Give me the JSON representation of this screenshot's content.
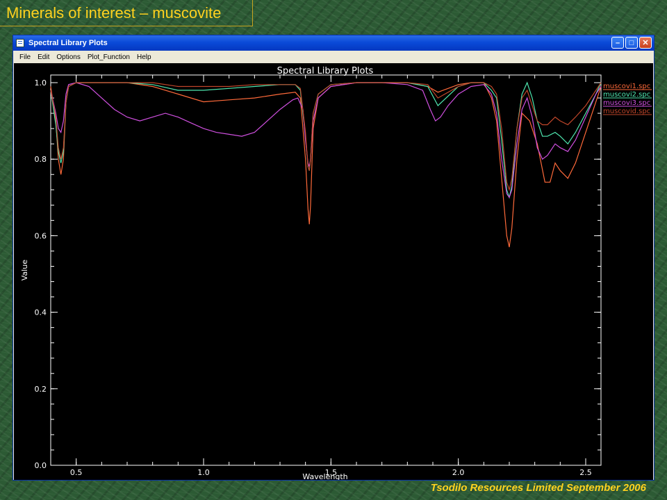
{
  "slide": {
    "title": "Minerals of interest – muscovite",
    "footer": "Tsodilo Resources Limited September 2006"
  },
  "window": {
    "title": "Spectral Library Plots",
    "menu": [
      "File",
      "Edit",
      "Options",
      "Plot_Function",
      "Help"
    ],
    "buttons": {
      "minimize": "–",
      "maximize": "□",
      "close": "✕"
    }
  },
  "chart_data": {
    "type": "line",
    "title": "Spectral Library Plots",
    "xlabel": "Wavelength",
    "ylabel": "Value",
    "xlim": [
      0.4,
      2.56
    ],
    "ylim": [
      0.0,
      1.02
    ],
    "xticks": [
      0.5,
      1.0,
      1.5,
      2.0,
      2.5
    ],
    "xtick_labels": [
      "0.5",
      "1.0",
      "1.5",
      "2.0",
      "2.5"
    ],
    "yticks": [
      0.0,
      0.2,
      0.4,
      0.6,
      0.8,
      1.0
    ],
    "ytick_labels": [
      "0.0",
      "0.2",
      "0.4",
      "0.6",
      "0.8",
      "1.0"
    ],
    "grid": false,
    "legend_position": "right",
    "series": [
      {
        "name": "muscovi1.spc",
        "color": "#ff6a3a",
        "points": [
          [
            0.4,
            0.99
          ],
          [
            0.42,
            0.9
          ],
          [
            0.43,
            0.8
          ],
          [
            0.44,
            0.76
          ],
          [
            0.45,
            0.8
          ],
          [
            0.46,
            0.95
          ],
          [
            0.47,
            0.99
          ],
          [
            0.5,
            1.0
          ],
          [
            0.6,
            1.0
          ],
          [
            0.7,
            1.0
          ],
          [
            0.8,
            0.99
          ],
          [
            0.9,
            0.97
          ],
          [
            1.0,
            0.95
          ],
          [
            1.1,
            0.955
          ],
          [
            1.2,
            0.96
          ],
          [
            1.3,
            0.97
          ],
          [
            1.36,
            0.975
          ],
          [
            1.38,
            0.96
          ],
          [
            1.4,
            0.8
          ],
          [
            1.41,
            0.67
          ],
          [
            1.415,
            0.63
          ],
          [
            1.42,
            0.68
          ],
          [
            1.43,
            0.88
          ],
          [
            1.45,
            0.96
          ],
          [
            1.5,
            0.99
          ],
          [
            1.6,
            1.0
          ],
          [
            1.7,
            1.0
          ],
          [
            1.8,
            1.0
          ],
          [
            1.88,
            0.99
          ],
          [
            1.92,
            0.975
          ],
          [
            1.96,
            0.985
          ],
          [
            2.0,
            0.995
          ],
          [
            2.05,
            1.0
          ],
          [
            2.1,
            1.0
          ],
          [
            2.13,
            0.96
          ],
          [
            2.15,
            0.9
          ],
          [
            2.17,
            0.75
          ],
          [
            2.19,
            0.6
          ],
          [
            2.2,
            0.57
          ],
          [
            2.21,
            0.62
          ],
          [
            2.23,
            0.8
          ],
          [
            2.25,
            0.92
          ],
          [
            2.28,
            0.9
          ],
          [
            2.31,
            0.84
          ],
          [
            2.34,
            0.74
          ],
          [
            2.36,
            0.74
          ],
          [
            2.38,
            0.79
          ],
          [
            2.4,
            0.77
          ],
          [
            2.43,
            0.75
          ],
          [
            2.46,
            0.79
          ],
          [
            2.5,
            0.87
          ],
          [
            2.54,
            0.95
          ],
          [
            2.56,
            0.99
          ]
        ]
      },
      {
        "name": "muscovi2.spc",
        "color": "#4fe8b0",
        "points": [
          [
            0.4,
            0.98
          ],
          [
            0.42,
            0.89
          ],
          [
            0.43,
            0.82
          ],
          [
            0.44,
            0.79
          ],
          [
            0.45,
            0.82
          ],
          [
            0.46,
            0.95
          ],
          [
            0.47,
            0.99
          ],
          [
            0.5,
            1.0
          ],
          [
            0.6,
            1.0
          ],
          [
            0.7,
            1.0
          ],
          [
            0.8,
            0.995
          ],
          [
            0.9,
            0.98
          ],
          [
            1.0,
            0.98
          ],
          [
            1.1,
            0.985
          ],
          [
            1.2,
            0.99
          ],
          [
            1.3,
            0.995
          ],
          [
            1.36,
            0.995
          ],
          [
            1.38,
            0.98
          ],
          [
            1.4,
            0.86
          ],
          [
            1.41,
            0.78
          ],
          [
            1.415,
            0.77
          ],
          [
            1.42,
            0.8
          ],
          [
            1.43,
            0.92
          ],
          [
            1.45,
            0.97
          ],
          [
            1.5,
            0.995
          ],
          [
            1.6,
            1.0
          ],
          [
            1.7,
            1.0
          ],
          [
            1.8,
            1.0
          ],
          [
            1.88,
            0.99
          ],
          [
            1.92,
            0.94
          ],
          [
            1.96,
            0.965
          ],
          [
            2.0,
            0.99
          ],
          [
            2.05,
            1.0
          ],
          [
            2.1,
            1.0
          ],
          [
            2.13,
            0.98
          ],
          [
            2.15,
            0.96
          ],
          [
            2.17,
            0.85
          ],
          [
            2.19,
            0.72
          ],
          [
            2.2,
            0.7
          ],
          [
            2.21,
            0.73
          ],
          [
            2.23,
            0.88
          ],
          [
            2.25,
            0.97
          ],
          [
            2.27,
            1.0
          ],
          [
            2.29,
            0.96
          ],
          [
            2.31,
            0.9
          ],
          [
            2.33,
            0.86
          ],
          [
            2.35,
            0.86
          ],
          [
            2.38,
            0.87
          ],
          [
            2.4,
            0.86
          ],
          [
            2.43,
            0.84
          ],
          [
            2.46,
            0.87
          ],
          [
            2.5,
            0.92
          ],
          [
            2.54,
            0.97
          ],
          [
            2.56,
            1.0
          ]
        ]
      },
      {
        "name": "muscovi3.spc",
        "color": "#d050e0",
        "points": [
          [
            0.4,
            0.98
          ],
          [
            0.42,
            0.92
          ],
          [
            0.43,
            0.88
          ],
          [
            0.44,
            0.87
          ],
          [
            0.45,
            0.9
          ],
          [
            0.46,
            0.97
          ],
          [
            0.47,
            0.995
          ],
          [
            0.5,
            1.0
          ],
          [
            0.55,
            0.99
          ],
          [
            0.6,
            0.96
          ],
          [
            0.65,
            0.93
          ],
          [
            0.7,
            0.91
          ],
          [
            0.75,
            0.9
          ],
          [
            0.8,
            0.91
          ],
          [
            0.85,
            0.92
          ],
          [
            0.9,
            0.91
          ],
          [
            0.95,
            0.895
          ],
          [
            1.0,
            0.88
          ],
          [
            1.05,
            0.87
          ],
          [
            1.1,
            0.865
          ],
          [
            1.15,
            0.86
          ],
          [
            1.2,
            0.87
          ],
          [
            1.25,
            0.9
          ],
          [
            1.3,
            0.93
          ],
          [
            1.35,
            0.955
          ],
          [
            1.37,
            0.96
          ],
          [
            1.39,
            0.93
          ],
          [
            1.4,
            0.85
          ],
          [
            1.41,
            0.79
          ],
          [
            1.415,
            0.78
          ],
          [
            1.42,
            0.8
          ],
          [
            1.43,
            0.9
          ],
          [
            1.45,
            0.96
          ],
          [
            1.5,
            0.99
          ],
          [
            1.6,
            1.0
          ],
          [
            1.7,
            1.0
          ],
          [
            1.8,
            0.995
          ],
          [
            1.86,
            0.98
          ],
          [
            1.89,
            0.93
          ],
          [
            1.91,
            0.9
          ],
          [
            1.93,
            0.91
          ],
          [
            1.96,
            0.94
          ],
          [
            2.0,
            0.97
          ],
          [
            2.05,
            0.99
          ],
          [
            2.1,
            0.995
          ],
          [
            2.13,
            0.97
          ],
          [
            2.15,
            0.92
          ],
          [
            2.17,
            0.8
          ],
          [
            2.19,
            0.71
          ],
          [
            2.2,
            0.7
          ],
          [
            2.21,
            0.72
          ],
          [
            2.23,
            0.84
          ],
          [
            2.25,
            0.93
          ],
          [
            2.27,
            0.96
          ],
          [
            2.29,
            0.91
          ],
          [
            2.31,
            0.83
          ],
          [
            2.33,
            0.8
          ],
          [
            2.35,
            0.81
          ],
          [
            2.38,
            0.84
          ],
          [
            2.4,
            0.83
          ],
          [
            2.43,
            0.82
          ],
          [
            2.46,
            0.85
          ],
          [
            2.5,
            0.91
          ],
          [
            2.54,
            0.97
          ],
          [
            2.56,
            0.99
          ]
        ]
      },
      {
        "name": "muscovid.spc",
        "color": "#c0462a",
        "points": [
          [
            0.4,
            0.98
          ],
          [
            0.42,
            0.91
          ],
          [
            0.43,
            0.83
          ],
          [
            0.44,
            0.8
          ],
          [
            0.45,
            0.83
          ],
          [
            0.46,
            0.95
          ],
          [
            0.47,
            0.99
          ],
          [
            0.5,
            1.0
          ],
          [
            0.6,
            1.0
          ],
          [
            0.7,
            1.0
          ],
          [
            0.8,
            1.0
          ],
          [
            0.9,
            0.99
          ],
          [
            1.0,
            0.99
          ],
          [
            1.1,
            0.99
          ],
          [
            1.2,
            0.995
          ],
          [
            1.3,
            0.995
          ],
          [
            1.36,
            0.995
          ],
          [
            1.38,
            0.985
          ],
          [
            1.4,
            0.87
          ],
          [
            1.41,
            0.78
          ],
          [
            1.415,
            0.77
          ],
          [
            1.42,
            0.8
          ],
          [
            1.43,
            0.92
          ],
          [
            1.45,
            0.97
          ],
          [
            1.5,
            0.995
          ],
          [
            1.6,
            1.0
          ],
          [
            1.7,
            1.0
          ],
          [
            1.8,
            1.0
          ],
          [
            1.88,
            0.995
          ],
          [
            1.92,
            0.96
          ],
          [
            1.96,
            0.975
          ],
          [
            2.0,
            0.99
          ],
          [
            2.05,
            1.0
          ],
          [
            2.1,
            1.0
          ],
          [
            2.13,
            0.99
          ],
          [
            2.15,
            0.97
          ],
          [
            2.17,
            0.88
          ],
          [
            2.19,
            0.74
          ],
          [
            2.2,
            0.72
          ],
          [
            2.21,
            0.75
          ],
          [
            2.23,
            0.88
          ],
          [
            2.25,
            0.96
          ],
          [
            2.27,
            0.98
          ],
          [
            2.29,
            0.94
          ],
          [
            2.31,
            0.9
          ],
          [
            2.33,
            0.89
          ],
          [
            2.35,
            0.89
          ],
          [
            2.38,
            0.91
          ],
          [
            2.4,
            0.9
          ],
          [
            2.43,
            0.89
          ],
          [
            2.46,
            0.91
          ],
          [
            2.5,
            0.94
          ],
          [
            2.54,
            0.98
          ],
          [
            2.56,
            1.0
          ]
        ]
      }
    ]
  }
}
